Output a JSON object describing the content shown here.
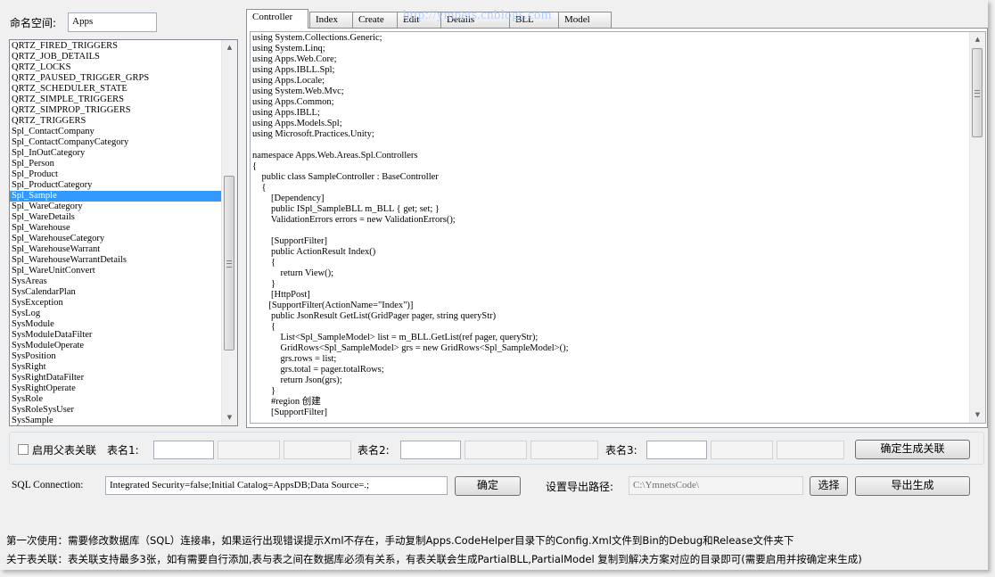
{
  "namespace": {
    "label": "命名空间:",
    "value": "Apps"
  },
  "tables": {
    "selected_index": 14,
    "items": [
      "QRTZ_FIRED_TRIGGERS",
      "QRTZ_JOB_DETAILS",
      "QRTZ_LOCKS",
      "QRTZ_PAUSED_TRIGGER_GRPS",
      "QRTZ_SCHEDULER_STATE",
      "QRTZ_SIMPLE_TRIGGERS",
      "QRTZ_SIMPROP_TRIGGERS",
      "QRTZ_TRIGGERS",
      "Spl_ContactCompany",
      "Spl_ContactCompanyCategory",
      "Spl_InOutCategory",
      "Spl_Person",
      "Spl_Product",
      "Spl_ProductCategory",
      "Spl_Sample",
      "Spl_WareCategory",
      "Spl_WareDetails",
      "Spl_Warehouse",
      "Spl_WarehouseCategory",
      "Spl_WarehouseWarrant",
      "Spl_WarehouseWarrantDetails",
      "Spl_WareUnitConvert",
      "SysAreas",
      "SysCalendarPlan",
      "SysException",
      "SysLog",
      "SysModule",
      "SysModuleDataFilter",
      "SysModuleOperate",
      "SysPosition",
      "SysRight",
      "SysRightDataFilter",
      "SysRightOperate",
      "SysRole",
      "SysRoleSysUser",
      "SysSample"
    ]
  },
  "tabs": [
    "Controller",
    "Index",
    "Create",
    "Edit",
    "Details",
    "BLL",
    "Model"
  ],
  "watermark": "http://ymnets.cnblogs.com",
  "code_lines": [
    "using System.Collections.Generic;",
    "using System.Linq;",
    "using Apps.Web.Core;",
    "using Apps.IBLL.Spl;",
    "using Apps.Locale;",
    "using System.Web.Mvc;",
    "using Apps.Common;",
    "using Apps.IBLL;",
    "using Apps.Models.Spl;",
    "using Microsoft.Practices.Unity;",
    "",
    "namespace Apps.Web.Areas.Spl.Controllers",
    "{",
    "    public class SampleController : BaseController",
    "    {",
    "        [Dependency]",
    "        public ISpl_SampleBLL m_BLL { get; set; }",
    "        ValidationErrors errors = new ValidationErrors();",
    "",
    "        [SupportFilter]",
    "        public ActionResult Index()",
    "        {",
    "            return View();",
    "        }",
    "        [HttpPost]",
    "       [SupportFilter(ActionName=\"Index\")]",
    "        public JsonResult GetList(GridPager pager, string queryStr)",
    "        {",
    "            List<Spl_SampleModel> list = m_BLL.GetList(ref pager, queryStr);",
    "            GridRows<Spl_SampleModel> grs = new GridRows<Spl_SampleModel>();",
    "            grs.rows = list;",
    "            grs.total = pager.totalRows;",
    "            return Json(grs);",
    "        }",
    "        #region 创建",
    "        [SupportFilter]"
  ],
  "relation": {
    "checkbox_label": "启用父表关联",
    "checked": false,
    "table1_label": "表名1:",
    "table2_label": "表名2:",
    "table3_label": "表名3:",
    "confirm_relation_button": "确定生成关联"
  },
  "sql": {
    "label": "SQL Connection:",
    "value": "Integrated Security=false;Initial Catalog=AppsDB;Data Source=.;",
    "ok_button": "确定"
  },
  "export": {
    "label": "设置导出路径:",
    "value": "C:\\YmnetsCode\\",
    "choose_button": "选择",
    "export_button": "导出生成"
  },
  "notes": [
    "第一次使用：需要修改数据库（SQL）连接串，如果运行出现错误提示Xml不存在，手动复制Apps.CodeHelper目录下的Config.Xml文件到Bin的Debug和Release文件夹下",
    "关于表关联：表关联支持最多3张，如有需要自行添加,表与表之间在数据库必须有关系，有表关联会生成PartialBLL,PartialModel 复制到解决方案对应的目录即可(需要启用并按确定来生成)"
  ]
}
